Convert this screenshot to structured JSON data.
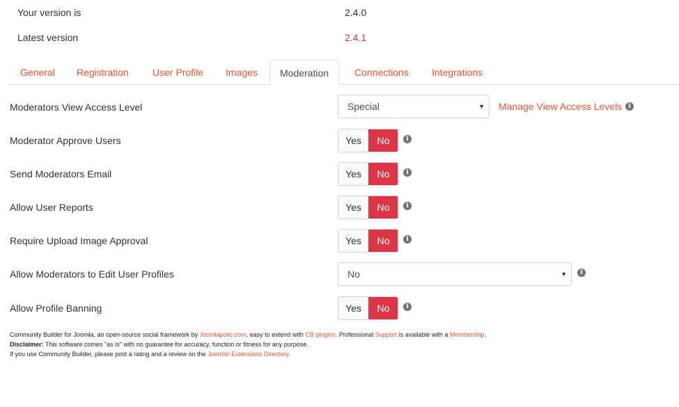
{
  "version": {
    "your_label": "Your version is",
    "your_value": "2.4.0",
    "latest_label": "Latest version",
    "latest_value": "2.4.1",
    "latest_color": "#dc3545"
  },
  "tabs": [
    {
      "label": "General"
    },
    {
      "label": "Registration"
    },
    {
      "label": "User Profile"
    },
    {
      "label": "Images"
    },
    {
      "label": "Moderation",
      "active": true
    },
    {
      "label": "Connections"
    },
    {
      "label": "Integrations"
    }
  ],
  "settings": {
    "view_access": {
      "label": "Moderators View Access Level",
      "value": "Special",
      "link": "Manage View Access Levels",
      "icon": "info-icon"
    },
    "approve_users": {
      "label": "Moderator Approve Users",
      "yes": "Yes",
      "no": "No",
      "selected": "No"
    },
    "send_email": {
      "label": "Send Moderators Email",
      "yes": "Yes",
      "no": "No",
      "selected": "No"
    },
    "user_reports": {
      "label": "Allow User Reports",
      "yes": "Yes",
      "no": "No",
      "selected": "No"
    },
    "image_approval": {
      "label": "Require Upload Image Approval",
      "yes": "Yes",
      "no": "No",
      "selected": "No"
    },
    "edit_profiles": {
      "label": "Allow Moderators to Edit User Profiles",
      "value": "No"
    },
    "profile_banning": {
      "label": "Allow Profile Banning",
      "yes": "Yes",
      "no": "No",
      "selected": "No"
    }
  },
  "footer": {
    "line1": {
      "t1": "Community Builder for Joomla, an open-source social framework by ",
      "l1": "Joomlapolis.com",
      "t2": ", easy to extend with ",
      "l2": "CB plugins",
      "t3": ". Professional ",
      "l3": "Support",
      "t4": " is available with a ",
      "l4": "Membership",
      "t5": "."
    },
    "line2": {
      "bold": "Disclaimer:",
      "text": " This software comes \"as is\" with no guarantee for accuracy, function or fitness for any purpose."
    },
    "line3": {
      "t1": "If you use Community Builder, please post a rating and a review on the ",
      "l1": "Joomla! Extensions Directory",
      "t2": "."
    }
  },
  "colors": {
    "accent": "#e9532e",
    "danger": "#dc3545"
  }
}
